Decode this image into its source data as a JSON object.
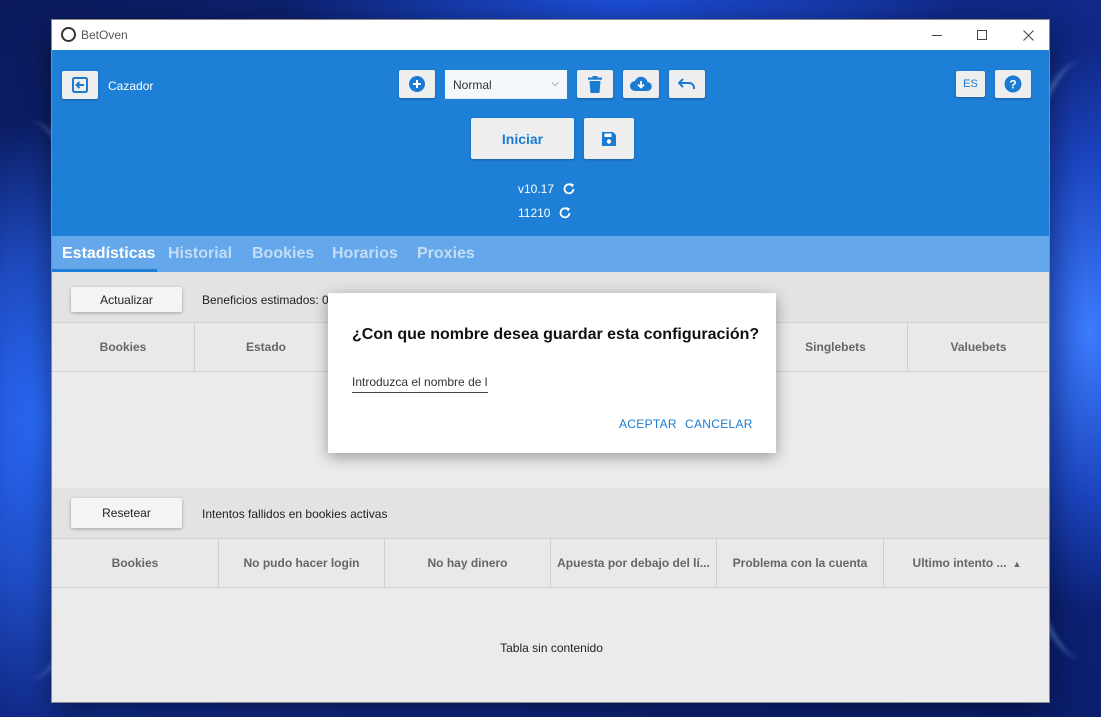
{
  "window": {
    "title": "BetOven"
  },
  "header": {
    "mode_label": "Cazador",
    "profile_value": "Normal",
    "language": "ES",
    "start_label": "Iniciar",
    "version": "v10.17",
    "build": "11210"
  },
  "tabs": [
    {
      "label": "Estadísticas",
      "active": true
    },
    {
      "label": "Historial",
      "active": false
    },
    {
      "label": "Bookies",
      "active": false
    },
    {
      "label": "Horarios",
      "active": false
    },
    {
      "label": "Proxies",
      "active": false
    }
  ],
  "stats": {
    "update_label": "Actualizar",
    "estimated_label": "Beneficios estimados: 0.",
    "columns": [
      "Bookies",
      "Estado",
      "",
      "",
      "",
      "Singlebets",
      "Valuebets"
    ]
  },
  "failures": {
    "reset_label": "Resetear",
    "title": "Intentos fallidos en bookies activas",
    "columns": [
      "Bookies",
      "No pudo hacer login",
      "No hay dinero",
      "Apuesta por debajo del lí...",
      "Problema con la cuenta",
      "Ultimo intento ..."
    ],
    "empty_text": "Tabla sin contenido"
  },
  "dialog": {
    "title": "¿Con que nombre desea guardar esta configuración?",
    "input_placeholder": "Introduzca el nombre de la configuración",
    "input_value": "",
    "accept_label": "ACEPTAR",
    "cancel_label": "CANCELAR"
  },
  "colors": {
    "header_blue": "#1e7fd6",
    "tabs_blue": "#64a7ea",
    "accent_text": "#1a7bd0"
  },
  "icons": [
    "exit-icon",
    "add-icon",
    "chevron-down-icon",
    "trash-icon",
    "cloud-download-icon",
    "undo-icon",
    "help-icon",
    "save-icon",
    "refresh-icon",
    "sort-asc-icon"
  ]
}
